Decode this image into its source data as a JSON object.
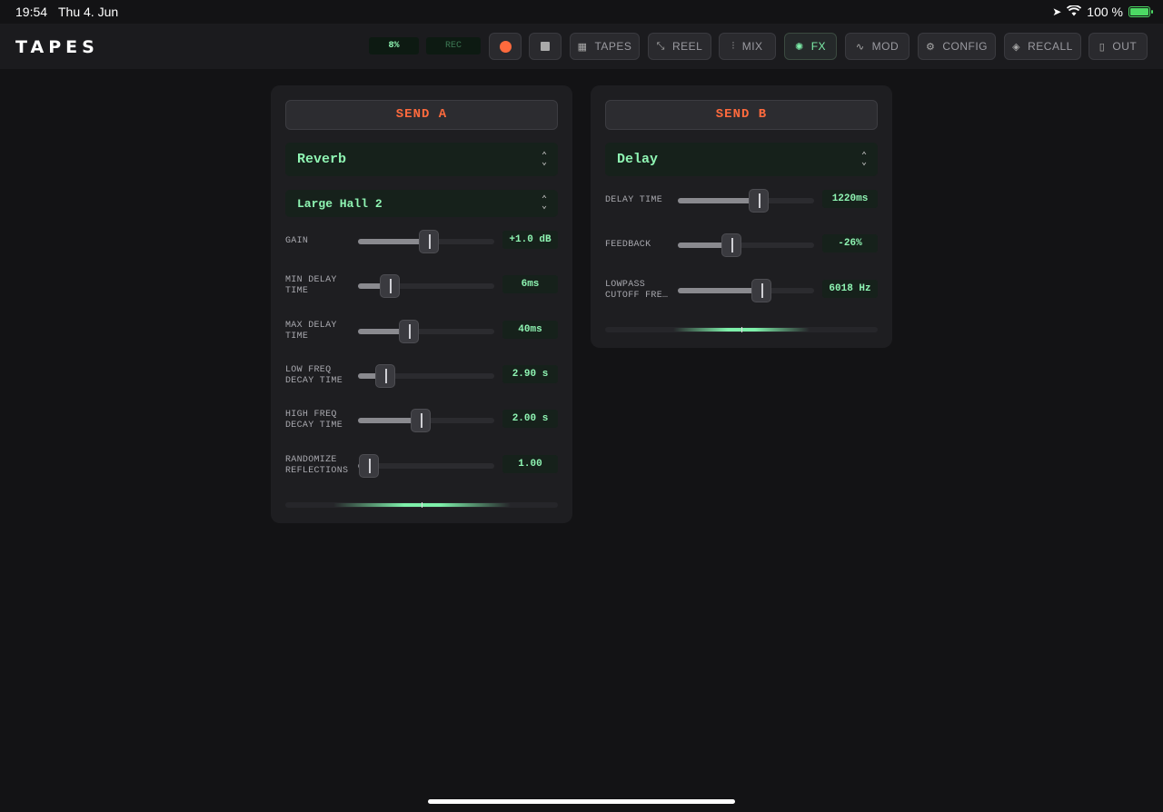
{
  "status": {
    "time": "19:54",
    "date": "Thu 4. Jun",
    "battery": "100 %",
    "battery_level": 1.0
  },
  "app": {
    "title": "TAPES"
  },
  "topbar": {
    "cpu": "8%",
    "rec": "REC",
    "colors": {
      "accent": "#7ef0aa",
      "record": "#ff6a3d"
    },
    "buttons": [
      {
        "label": "TAPES",
        "icon": "grid-icon"
      },
      {
        "label": "REEL",
        "icon": "expand-arrows-icon"
      },
      {
        "label": "MIX",
        "icon": "faders-icon"
      },
      {
        "label": "FX",
        "icon": "sparkle-icon",
        "active": true
      },
      {
        "label": "MOD",
        "icon": "waveform-icon"
      },
      {
        "label": "CONFIG",
        "icon": "gear-icon"
      },
      {
        "label": "RECALL",
        "icon": "layers-icon"
      },
      {
        "label": "OUT",
        "icon": "speaker-icon"
      }
    ]
  },
  "send_a": {
    "title": "SEND A",
    "effect": "Reverb",
    "preset": "Large Hall 2",
    "params": [
      {
        "label": "GAIN",
        "value": "+1.0 dB",
        "level": 0.52
      },
      {
        "label": "MIN DELAY\nTIME",
        "value": "6ms",
        "level": 0.23
      },
      {
        "label": "MAX DELAY\nTIME",
        "value": "40ms",
        "level": 0.37
      },
      {
        "label": "LOW FREQ\nDECAY TIME",
        "value": "2.90 s",
        "level": 0.2
      },
      {
        "label": "HIGH FREQ\nDECAY TIME",
        "value": "2.00 s",
        "level": 0.46
      },
      {
        "label": "RANDOMIZE\nREFLECTIONS",
        "value": "1.00",
        "level": 0.08
      }
    ],
    "meter_level": 0.65
  },
  "send_b": {
    "title": "SEND B",
    "effect": "Delay",
    "params": [
      {
        "label": "DELAY TIME",
        "value": "1220ms",
        "level": 0.59
      },
      {
        "label": "FEEDBACK",
        "value": "-26%",
        "level": 0.39
      },
      {
        "label": "LOWPASS\nCUTOFF FRE…",
        "value": "6018 Hz",
        "level": 0.61
      }
    ],
    "meter_level": 0.5
  }
}
